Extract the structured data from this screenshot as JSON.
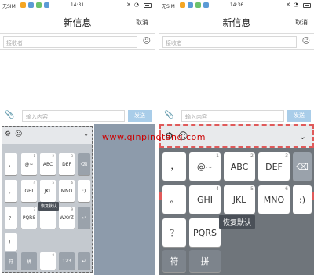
{
  "left": {
    "status": {
      "carrier": "无SIM",
      "time": "14:31"
    },
    "title": "新信息",
    "cancel": "取消",
    "recipient_placeholder": "接收者",
    "message_placeholder": "输入内容",
    "send": "发送",
    "keys_row1": [
      {
        "label": "",
        "num": "1"
      },
      {
        "label": "@~",
        "num": ""
      },
      {
        "label": "ABC",
        "num": "2"
      },
      {
        "label": "DEF",
        "num": "3"
      }
    ],
    "keys_row2": [
      {
        "label": "GHI",
        "num": "4"
      },
      {
        "label": "JKL",
        "num": "5"
      },
      {
        "label": "MNO",
        "num": "6"
      },
      {
        "label": ":)",
        "num": ""
      }
    ],
    "keys_row3": [
      {
        "label": "PQRS",
        "num": "7"
      },
      {
        "label": "",
        "num": "8"
      },
      {
        "label": "WXYZ",
        "num": "9"
      }
    ],
    "keys_row4": [
      {
        "label": "符",
        "num": ""
      },
      {
        "label": "拼",
        "num": ""
      },
      {
        "label": "",
        "num": "0"
      },
      {
        "label": "123",
        "num": ""
      }
    ],
    "tooltip": "恢复默认",
    "punct_left": [
      "，",
      "。",
      "？",
      "！"
    ]
  },
  "right": {
    "status": {
      "carrier": "无SIM",
      "time": "14:36"
    },
    "title": "新信息",
    "cancel": "取消",
    "recipient_placeholder": "接收者",
    "message_placeholder": "输入内容",
    "send": "发送",
    "keys_row1": [
      {
        "label": "，",
        "num": ""
      },
      {
        "label": "@~",
        "num": "1"
      },
      {
        "label": "ABC",
        "num": "2"
      },
      {
        "label": "DEF",
        "num": "3"
      }
    ],
    "keys_row2": [
      {
        "label": "。",
        "num": ""
      },
      {
        "label": "GHI",
        "num": "4"
      },
      {
        "label": "JKL",
        "num": "5"
      },
      {
        "label": "MNO",
        "num": "6"
      },
      {
        "label": ":)",
        "num": ""
      }
    ],
    "keys_row3": [
      {
        "label": "？",
        "num": ""
      },
      {
        "label": "PQRS",
        "num": ""
      }
    ],
    "keys_row4": [
      {
        "label": "符",
        "num": ""
      },
      {
        "label": "拼",
        "num": ""
      }
    ],
    "tooltip": "恢复默认"
  },
  "watermark": "www.qinpingtang.com",
  "colors": {
    "send_bg": "#a9cde9",
    "accent_red": "#e05a5a",
    "keyboard_bg": "#c4c9cf"
  }
}
